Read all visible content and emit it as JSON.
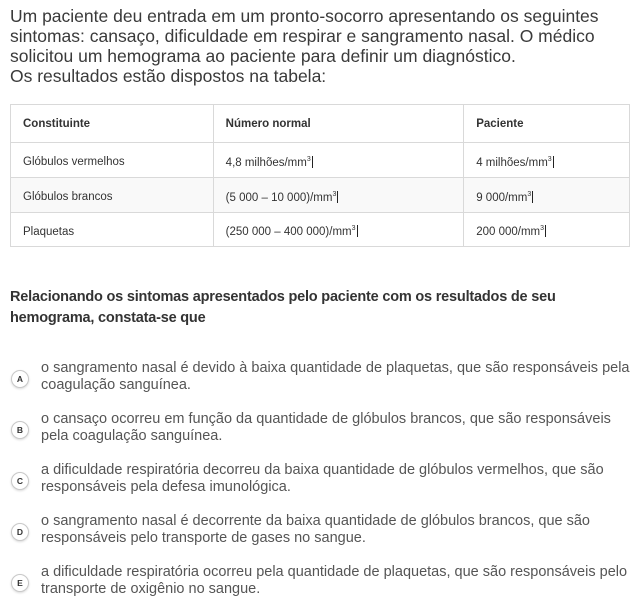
{
  "intro": {
    "line1": "Um paciente deu entrada em um pronto-socorro apresentando os seguintes sintomas: cansaço, dificuldade em respirar e sangramento nasal. O médico solicitou um hemograma ao paciente para definir um diagnóstico.",
    "line2": "Os resultados estão dispostos na tabela:"
  },
  "table": {
    "headers": [
      "Constituinte",
      "Número normal",
      "Paciente"
    ],
    "rows": [
      {
        "constituent": "Glóbulos vermelhos",
        "normal": "4,8 milhões/mm",
        "normal_exp": "3",
        "patient": "4 milhões/mm",
        "patient_exp": "3"
      },
      {
        "constituent": "Glóbulos brancos",
        "normal": "(5 000 – 10 000)/mm",
        "normal_exp": "3",
        "patient": "9 000/mm",
        "patient_exp": "3"
      },
      {
        "constituent": "Plaquetas",
        "normal": "(250 000 – 400 000)/mm",
        "normal_exp": "3",
        "patient": "200 000/mm",
        "patient_exp": "3"
      }
    ]
  },
  "question": "Relacionando os sintomas apresentados pelo paciente com os resultados de seu hemograma, constata-se que",
  "options": [
    {
      "letter": "A",
      "text": "o sangramento nasal é devido à baixa quantidade de plaquetas, que são responsáveis pela coagulação sanguínea."
    },
    {
      "letter": "B",
      "text": "o cansaço ocorreu em função da quantidade de glóbulos brancos, que são responsáveis pela coagulação sanguínea."
    },
    {
      "letter": "C",
      "text": "a dificuldade respiratória decorreu da baixa quantidade de glóbulos vermelhos, que são responsáveis pela defesa imunológica."
    },
    {
      "letter": "D",
      "text": "o sangramento nasal é decorrente da baixa quantidade de glóbulos brancos, que são responsáveis pelo transporte de gases no sangue."
    },
    {
      "letter": "E",
      "text": "a dificuldade respiratória ocorreu pela quantidade de plaquetas, que são responsáveis pelo transporte de oxigênio no sangue."
    }
  ]
}
